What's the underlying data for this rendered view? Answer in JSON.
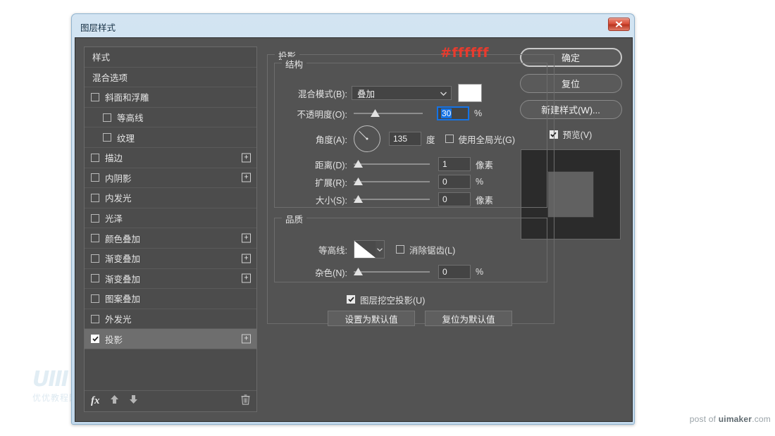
{
  "window": {
    "title": "图层样式",
    "close_label": "关闭"
  },
  "annotation": {
    "text": "#ffffff",
    "color": "#e83b2e"
  },
  "sidebar": {
    "items": [
      {
        "label": "样式",
        "type": "header",
        "checkbox": null,
        "expand": false
      },
      {
        "label": "混合选项",
        "type": "header",
        "checkbox": null,
        "expand": false
      },
      {
        "label": "斜面和浮雕",
        "type": "item",
        "checkbox": false,
        "expand": false
      },
      {
        "label": "等高线",
        "type": "sub",
        "checkbox": false,
        "expand": false
      },
      {
        "label": "纹理",
        "type": "sub",
        "checkbox": false,
        "expand": false
      },
      {
        "label": "描边",
        "type": "item",
        "checkbox": false,
        "expand": true
      },
      {
        "label": "内阴影",
        "type": "item",
        "checkbox": false,
        "expand": true
      },
      {
        "label": "内发光",
        "type": "item",
        "checkbox": false,
        "expand": false
      },
      {
        "label": "光泽",
        "type": "item",
        "checkbox": false,
        "expand": false
      },
      {
        "label": "颜色叠加",
        "type": "item",
        "checkbox": false,
        "expand": true
      },
      {
        "label": "渐变叠加",
        "type": "item",
        "checkbox": false,
        "expand": true
      },
      {
        "label": "渐变叠加",
        "type": "item",
        "checkbox": false,
        "expand": true
      },
      {
        "label": "图案叠加",
        "type": "item",
        "checkbox": false,
        "expand": false
      },
      {
        "label": "外发光",
        "type": "item",
        "checkbox": false,
        "expand": false
      },
      {
        "label": "投影",
        "type": "item",
        "checkbox": true,
        "expand": true,
        "selected": true
      }
    ],
    "footer": {
      "fx_label": "fx",
      "move_up_label": "上移",
      "move_down_label": "下移",
      "delete_label": "删除"
    }
  },
  "main": {
    "section_title": "投影",
    "structure": {
      "legend": "结构",
      "blend_mode_label": "混合模式(B):",
      "blend_mode_value": "叠加",
      "color_swatch": "#ffffff",
      "opacity_label": "不透明度(O):",
      "opacity_value": "30",
      "opacity_unit": "%",
      "angle_label": "角度(A):",
      "angle_value": "135",
      "angle_unit": "度",
      "global_light_label": "使用全局光(G)",
      "global_light_checked": false,
      "distance_label": "距离(D):",
      "distance_value": "1",
      "distance_unit": "像素",
      "spread_label": "扩展(R):",
      "spread_value": "0",
      "spread_unit": "%",
      "size_label": "大小(S):",
      "size_value": "0",
      "size_unit": "像素"
    },
    "quality": {
      "legend": "品质",
      "contour_label": "等高线:",
      "antialias_label": "消除锯齿(L)",
      "antialias_checked": false,
      "noise_label": "杂色(N):",
      "noise_value": "0",
      "noise_unit": "%"
    },
    "knockout_label": "图层挖空投影(U)",
    "knockout_checked": true,
    "make_default_label": "设置为默认值",
    "reset_default_label": "复位为默认值"
  },
  "buttons": {
    "ok": "确定",
    "reset": "复位",
    "new_style": "新建样式(W)...",
    "preview_label": "预览(V)",
    "preview_checked": true
  },
  "watermarks": {
    "left_logo": "UIII",
    "left_sub": "优优教程网",
    "right_prefix": "post of ",
    "right_brand": "uimaker",
    "right_suffix": ".com"
  }
}
